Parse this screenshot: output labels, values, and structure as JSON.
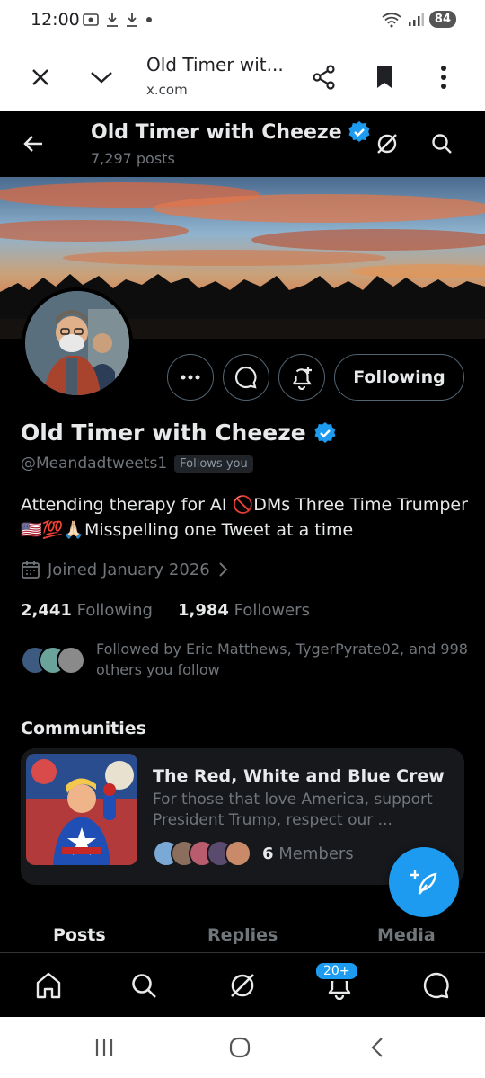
{
  "status_bar": {
    "time": "12:00",
    "battery": "84"
  },
  "browser": {
    "title": "Old Timer wit...",
    "url": "x.com"
  },
  "header": {
    "name": "Old Timer with Cheeze",
    "posts": "7,297 posts"
  },
  "profile": {
    "name": "Old Timer with Cheeze",
    "handle": "@Meandadtweets1",
    "follows_you": "Follows you",
    "bio": "Attending therapy for AI 🚫DMs Three Time Trumper🇺🇸💯🙏🏻Misspelling one Tweet at a time",
    "joined": "Joined January 2026",
    "following_count": "2,441",
    "following_label": "Following",
    "followers_count": "1,984",
    "followers_label": "Followers",
    "followed_by": "Followed by Eric Matthews, TygerPyrate02, and 998 others you follow",
    "following_button": "Following"
  },
  "communities": {
    "title": "Communities",
    "items": [
      {
        "name": "The Red, White and Blue Crew",
        "description": "For those that love America, support President Trump, respect our ...",
        "member_count": "6",
        "member_label": "Members"
      }
    ]
  },
  "tabs": [
    "Posts",
    "Replies",
    "Media"
  ],
  "bottom_nav": {
    "items": [
      "home-icon",
      "search-icon",
      "grok-icon",
      "notifications-icon",
      "messages-icon"
    ],
    "notification_badge": "20+"
  },
  "colors": {
    "accent": "#1d9bf0",
    "background": "#000000",
    "text_primary": "#e7e9ea",
    "text_secondary": "#71767b"
  }
}
